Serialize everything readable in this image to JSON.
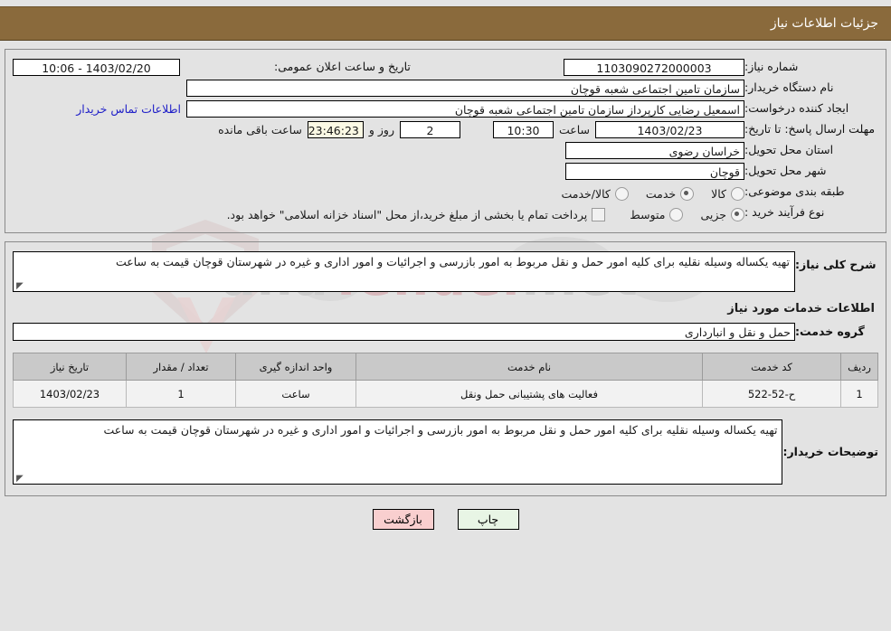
{
  "header": {
    "title": "جزئیات اطلاعات نیاز"
  },
  "colors": {
    "header_bg": "#8a6a3c",
    "link": "#2020c8",
    "print_btn_bg": "#e8f5e5",
    "back_btn_bg": "#f9cfcf"
  },
  "watermark": {
    "text_left": "ana",
    "text_accent": "Tender",
    "text_right": ".net"
  },
  "info": {
    "need_number_label": "شماره نیاز:",
    "need_number_value": "1103090272000003",
    "announce_datetime_label": "تاریخ و ساعت اعلان عمومی:",
    "announce_datetime_value": "1403/02/20 - 10:06",
    "buyer_org_label": "نام دستگاه خریدار:",
    "buyer_org_value": "سازمان تامین اجتماعی شعبه قوچان",
    "creator_label": "ایجاد کننده درخواست:",
    "creator_value": "اسمعیل رضایی کارپرداز سازمان تامین اجتماعی شعبه قوچان",
    "contact_link": "اطلاعات تماس خریدار",
    "deadline_label": "مهلت ارسال پاسخ: تا تاریخ:",
    "deadline_date": "1403/02/23",
    "deadline_hour_label": "ساعت",
    "deadline_hour_value": "10:30",
    "remaining_days": "2",
    "remaining_days_label": "روز و",
    "remaining_time": "23:46:23",
    "remaining_time_label": "ساعت باقی مانده",
    "province_label": "استان محل تحویل:",
    "province_value": "خراسان رضوی",
    "city_label": "شهر محل تحویل:",
    "city_value": "قوچان",
    "category_label": "طبقه بندی موضوعی:",
    "category_options": [
      {
        "label": "کالا",
        "selected": false
      },
      {
        "label": "خدمت",
        "selected": true
      },
      {
        "label": "کالا/خدمت",
        "selected": false
      }
    ],
    "process_label": "نوع فرآیند خرید :",
    "process_options": [
      {
        "label": "جزیی",
        "selected": true
      },
      {
        "label": "متوسط",
        "selected": false
      }
    ],
    "treasury_checkbox_label": "پرداخت تمام یا بخشی از مبلغ خرید،از محل \"اسناد خزانه اسلامی\" خواهد بود.",
    "treasury_checked": false
  },
  "summary": {
    "label": "شرح کلی نیاز:",
    "value": "تهیه یکساله وسیله نقلیه برای کلیه امور حمل و نقل مربوط به امور بازرسی و اجرائیات و امور اداری و غیره در شهرستان قوچان قیمت به ساعت"
  },
  "services": {
    "section_title": "اطلاعات خدمات مورد نیاز",
    "group_label": "گروه خدمت:",
    "group_value": "حمل و نقل و انبارداری",
    "columns": [
      "ردیف",
      "کد خدمت",
      "نام خدمت",
      "واحد اندازه گیری",
      "تعداد / مقدار",
      "تاریخ نیاز"
    ],
    "rows": [
      {
        "index": "1",
        "code": "ح-52-522",
        "name": "فعالیت های پشتیبانی حمل ونقل",
        "unit": "ساعت",
        "quantity": "1",
        "need_date": "1403/02/23"
      }
    ]
  },
  "buyer_notes": {
    "label": "توضیحات خریدار:",
    "value": "تهیه یکساله وسیله نقلیه برای کلیه امور حمل و نقل مربوط به امور بازرسی و اجرائیات و امور اداری و غیره در شهرستان قوچان قیمت به ساعت"
  },
  "buttons": {
    "print": "چاپ",
    "back": "بازگشت"
  }
}
